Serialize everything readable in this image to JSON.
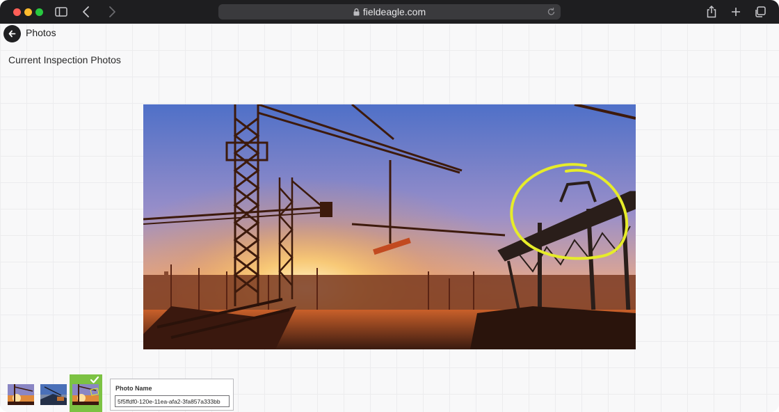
{
  "browser": {
    "url": "fieldeagle.com"
  },
  "page": {
    "title": "Photos",
    "section_title": "Current Inspection Photos"
  },
  "photo_panel": {
    "label": "Photo Name",
    "value": "5f5ffdf0-120e-11ea-afa2-3fa857a333bb"
  },
  "thumbnails": {
    "count": 3,
    "selected_index": 2
  },
  "colors": {
    "selected_thumb": "#7cc243",
    "annotation": "#e6ec2a"
  },
  "icons": [
    "sidebar-toggle-icon",
    "back-arrow-icon",
    "forward-arrow-icon",
    "lock-icon",
    "reload-icon",
    "share-icon",
    "plus-icon",
    "tabs-icon",
    "checkmark-icon"
  ]
}
